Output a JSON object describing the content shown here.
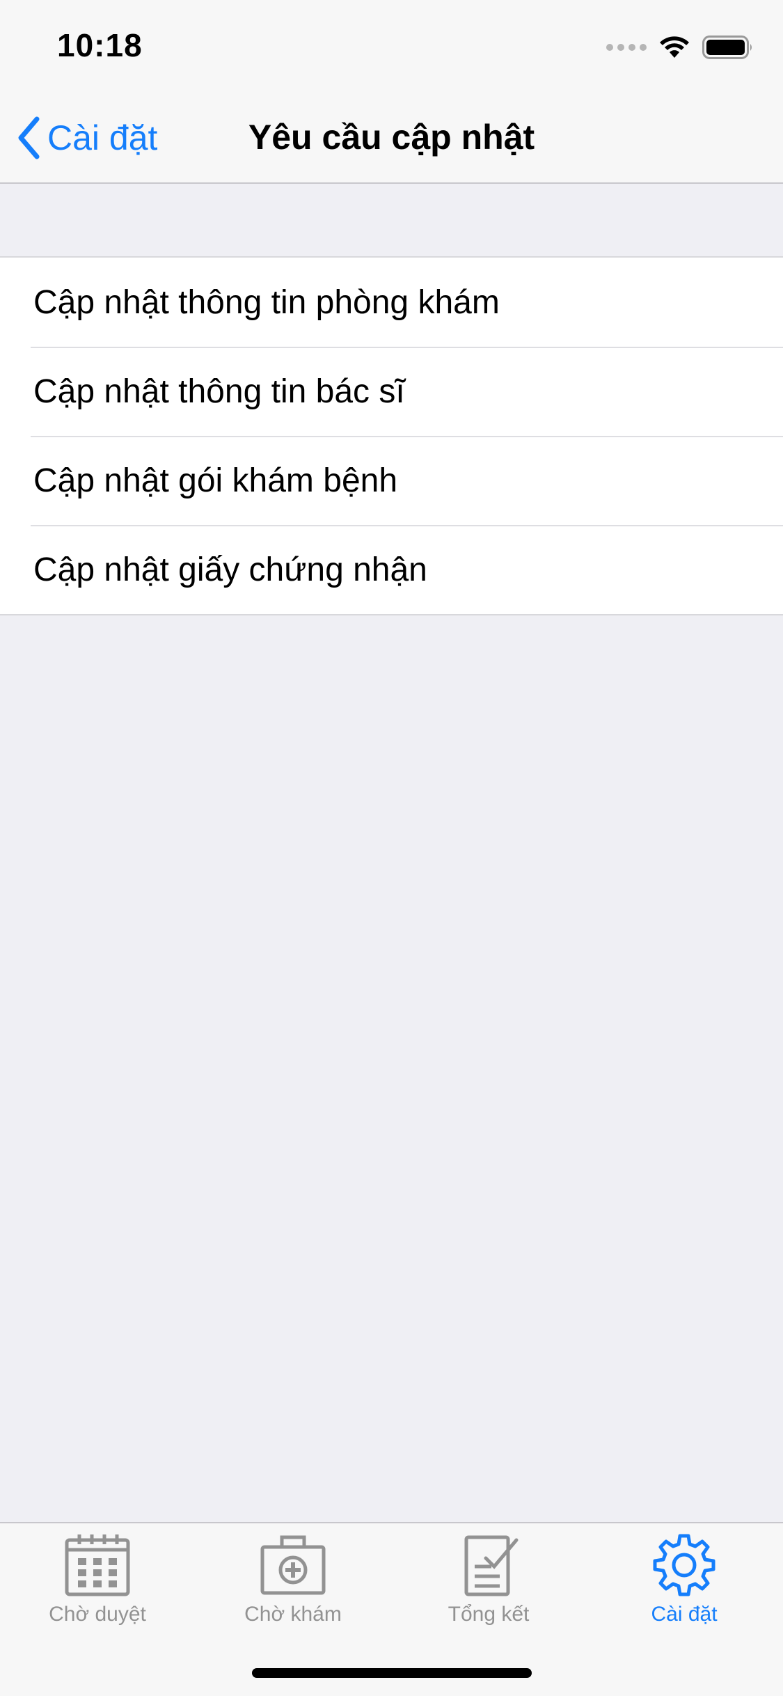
{
  "status_bar": {
    "time": "10:18",
    "icons": [
      "signal-icon",
      "wifi-icon",
      "battery-icon"
    ]
  },
  "nav": {
    "back_label": "Cài đặt",
    "title": "Yêu cầu cập nhật"
  },
  "list": {
    "items": [
      {
        "label": "Cập nhật thông tin phòng khám"
      },
      {
        "label": "Cập nhật thông tin bác sĩ"
      },
      {
        "label": "Cập nhật gói khám bệnh"
      },
      {
        "label": "Cập nhật giấy chứng nhận"
      }
    ]
  },
  "tabs": [
    {
      "label": "Chờ duyệt",
      "icon": "calendar-icon",
      "active": false
    },
    {
      "label": "Chờ khám",
      "icon": "medical-kit-icon",
      "active": false
    },
    {
      "label": "Tổng kết",
      "icon": "checklist-icon",
      "active": false
    },
    {
      "label": "Cài đặt",
      "icon": "gear-icon",
      "active": true
    }
  ],
  "colors": {
    "accent": "#157efb",
    "inactive": "#929292",
    "background": "#efeff4"
  }
}
